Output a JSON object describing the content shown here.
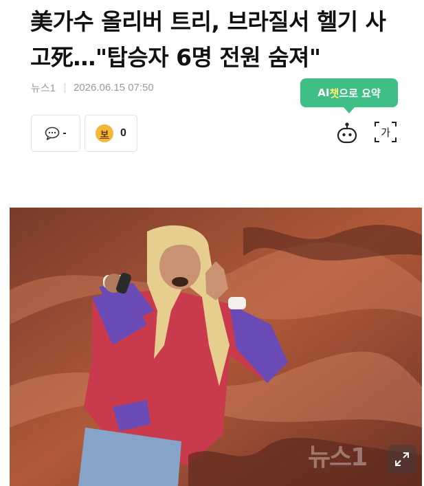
{
  "article": {
    "headline": "美가수 올리버 트리, 브라질서 헬기 사고死…\"탑승자 6명 전원 숨져\"",
    "source": "뉴스1",
    "datetime": "2026.06.15 07:50"
  },
  "ai_summary": {
    "prefix": "AI",
    "highlight": "챗",
    "suffix": "으로 요약"
  },
  "actions": {
    "comment_count": "-",
    "reaction_count": "0",
    "reaction_icon_glyph": "보"
  },
  "icons": {
    "comment": "comment-icon",
    "reaction": "reaction-icon",
    "robot": "ai-robot-icon",
    "font_size": "font-size-icon",
    "expand": "expand-icon"
  },
  "font_size_glyph": "가",
  "photo": {
    "watermark": "뉴스1"
  },
  "colors": {
    "ai_badge": "#3fbf86",
    "ai_highlight": "#fff36b",
    "reaction": "#f4b73a"
  }
}
